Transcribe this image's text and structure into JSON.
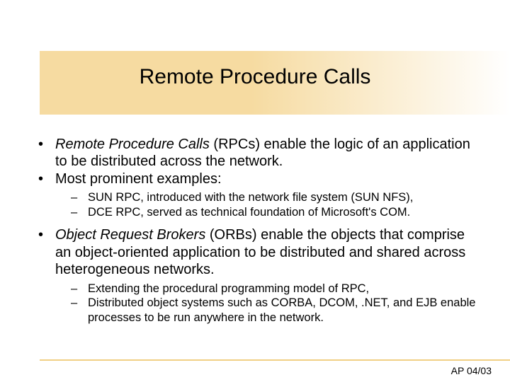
{
  "title": "Remote Procedure Calls",
  "bullets": {
    "b1_em": "Remote Procedure Calls",
    "b1_rest": " (RPCs) enable the logic of an application to be distributed across the network.",
    "b2": "Most prominent examples:",
    "b2_sub1": "SUN RPC, introduced with the network file system (SUN NFS),",
    "b2_sub2": "DCE RPC, served as technical foundation of Microsoft's COM.",
    "b3_em": "Object Request Brokers",
    "b3_rest": " (ORBs) enable the objects that comprise an object-oriented application to be distributed and shared across heterogeneous networks.",
    "b3_sub1": "Extending the procedural programming model of RPC,",
    "b3_sub2": "Distributed object systems such as CORBA, DCOM, .NET, and EJB enable processes to be run anywhere in the network."
  },
  "footer": "AP 04/03"
}
